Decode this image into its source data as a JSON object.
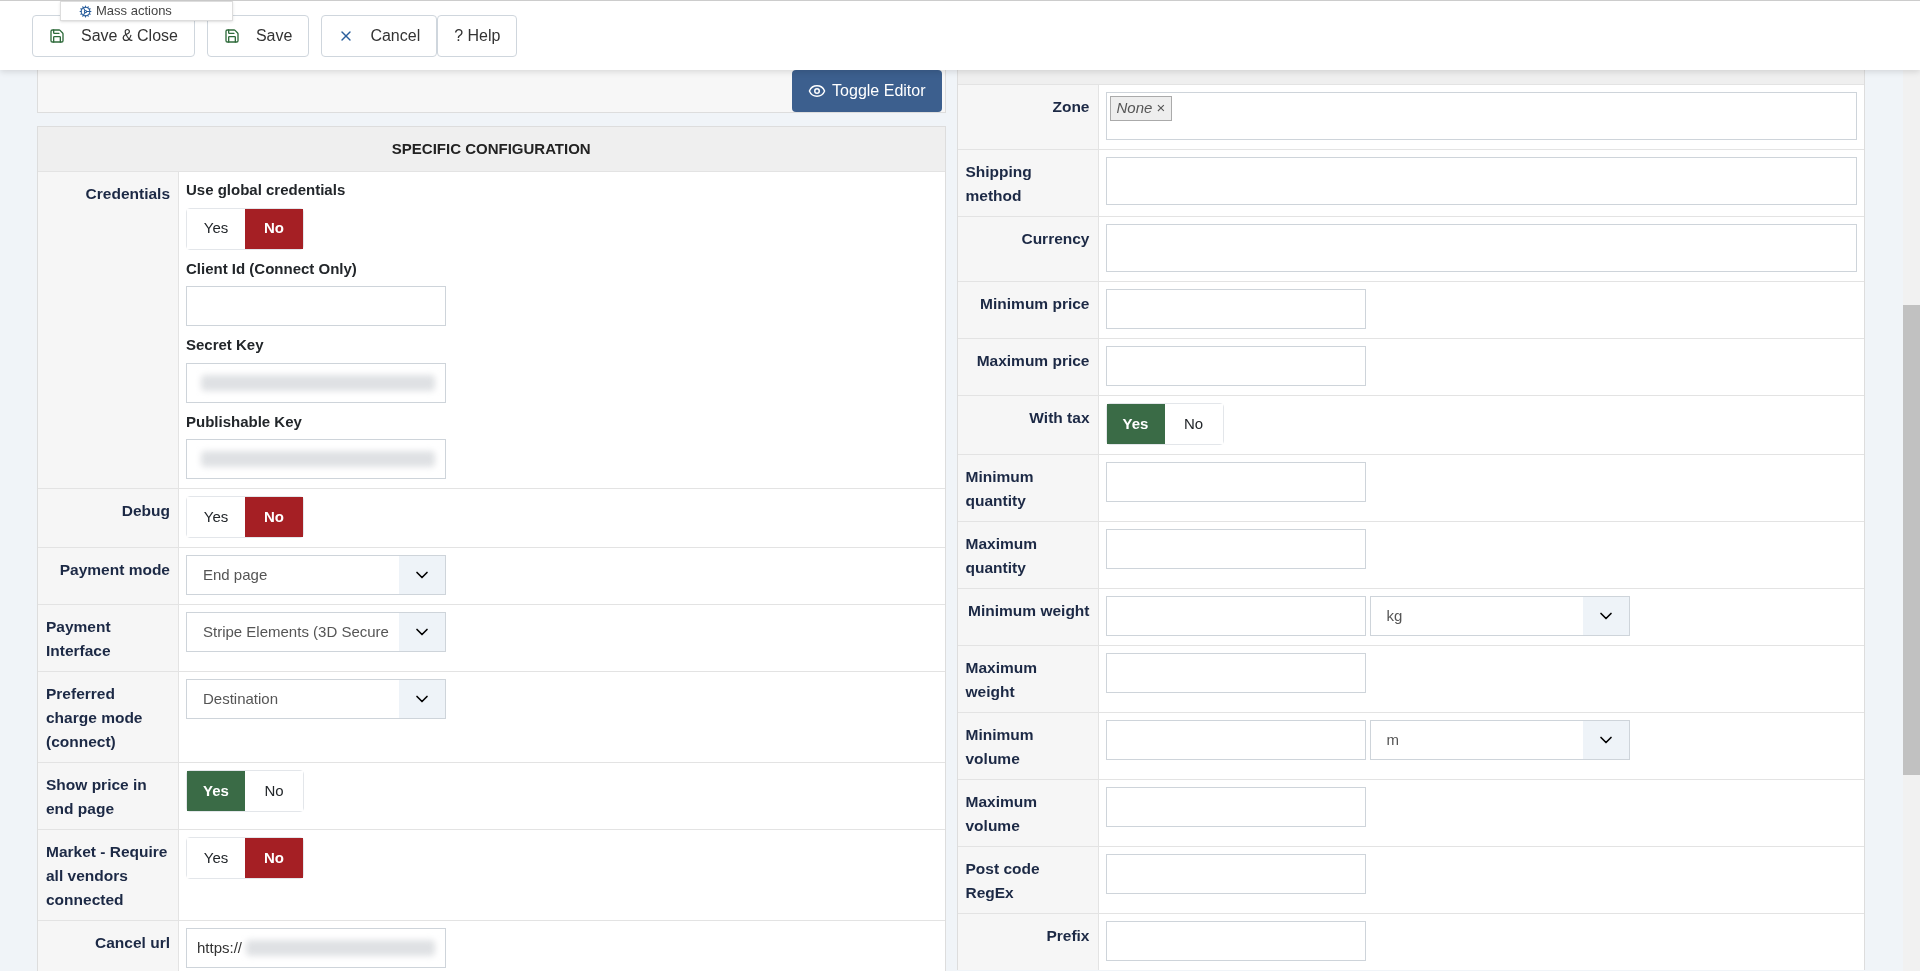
{
  "toolbar": {
    "mass_actions": "Mass actions",
    "buttons": [
      {
        "label": "Save & Close",
        "kind": "save"
      },
      {
        "label": "Save",
        "kind": "save"
      },
      {
        "label": "Cancel",
        "kind": "cancel"
      },
      {
        "label": "? Help",
        "kind": "help"
      }
    ]
  },
  "editor": {
    "toggle_button": "Toggle Editor"
  },
  "specific_configuration": {
    "title": "SPECIFIC CONFIGURATION",
    "rows": [
      {
        "label": "Credentials",
        "controls": [
          {
            "kind": "toggle",
            "caption": "Use global credentials",
            "options": [
              {
                "label": "Yes",
                "selected": false
              },
              {
                "label": "No",
                "selected": true
              }
            ]
          },
          {
            "kind": "text",
            "caption": "Client Id (Connect Only)"
          },
          {
            "kind": "text",
            "caption": "Secret Key",
            "blurred": true
          },
          {
            "kind": "text",
            "caption": "Publishable Key",
            "blurred": true
          }
        ]
      },
      {
        "label": "Debug",
        "controls": [
          {
            "kind": "toggle",
            "options": [
              {
                "label": "Yes",
                "selected": false
              },
              {
                "label": "No",
                "selected": true
              }
            ]
          }
        ]
      },
      {
        "label": "Payment mode",
        "controls": [
          {
            "kind": "select",
            "value": "End page"
          }
        ]
      },
      {
        "label": "Payment Interface",
        "controls": [
          {
            "kind": "select",
            "value": "Stripe Elements (3D Secure"
          }
        ]
      },
      {
        "label": "Preferred charge mode (connect)",
        "controls": [
          {
            "kind": "select",
            "value": "Destination"
          }
        ]
      },
      {
        "label": "Show price in end page",
        "controls": [
          {
            "kind": "toggle",
            "options": [
              {
                "label": "Yes",
                "selected": true
              },
              {
                "label": "No",
                "selected": false
              }
            ]
          }
        ]
      },
      {
        "label": "Market - Require all vendors connected",
        "controls": [
          {
            "kind": "toggle",
            "options": [
              {
                "label": "Yes",
                "selected": false
              },
              {
                "label": "No",
                "selected": true
              }
            ]
          }
        ]
      },
      {
        "label": "Cancel url",
        "controls": [
          {
            "kind": "text",
            "value": "https://",
            "blurred": true
          }
        ]
      }
    ]
  },
  "restrictions": {
    "rows": [
      {
        "label": "Zone",
        "controls": [
          {
            "kind": "tags",
            "tags": [
              {
                "label": "None",
                "remove": "×"
              }
            ]
          }
        ]
      },
      {
        "label": "Shipping method",
        "controls": [
          {
            "kind": "wide"
          }
        ]
      },
      {
        "label": "Currency",
        "controls": [
          {
            "kind": "wide"
          }
        ]
      },
      {
        "label": "Minimum price",
        "controls": [
          {
            "kind": "text"
          }
        ]
      },
      {
        "label": "Maximum price",
        "controls": [
          {
            "kind": "text"
          }
        ]
      },
      {
        "label": "With tax",
        "controls": [
          {
            "kind": "toggle",
            "options": [
              {
                "label": "Yes",
                "selected": true
              },
              {
                "label": "No",
                "selected": false
              }
            ]
          }
        ]
      },
      {
        "label": "Minimum quantity",
        "controls": [
          {
            "kind": "text"
          }
        ]
      },
      {
        "label": "Maximum quantity",
        "controls": [
          {
            "kind": "text"
          }
        ]
      },
      {
        "label": "Minimum weight",
        "controls": [
          {
            "kind": "text"
          },
          {
            "kind": "select",
            "value": "kg"
          }
        ]
      },
      {
        "label": "Maximum weight",
        "controls": [
          {
            "kind": "text"
          }
        ]
      },
      {
        "label": "Minimum volume",
        "controls": [
          {
            "kind": "text"
          },
          {
            "kind": "select",
            "value": "m"
          }
        ]
      },
      {
        "label": "Maximum volume",
        "controls": [
          {
            "kind": "text"
          }
        ]
      },
      {
        "label": "Post code RegEx",
        "controls": [
          {
            "kind": "text"
          }
        ]
      },
      {
        "label": "Prefix",
        "controls": [
          {
            "kind": "text"
          }
        ]
      }
    ]
  }
}
